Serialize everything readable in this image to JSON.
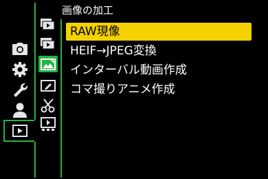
{
  "header": {
    "title": "画像の加工"
  },
  "menu": {
    "items": [
      {
        "label": "RAW現像",
        "selected": true
      },
      {
        "label": "HEIF→JPEG変換",
        "selected": false
      },
      {
        "label": "インターバル動画作成",
        "selected": false
      },
      {
        "label": "コマ撮りアニメ作成",
        "selected": false
      }
    ]
  },
  "tabs": {
    "main": [
      "camera-icon",
      "gear-icon",
      "wrench-icon",
      "person-icon",
      "playback-icon"
    ],
    "sub": [
      "playback-mode-icon",
      "display-icon",
      "image-edit-icon",
      "add-edit-info-icon",
      "delete-icon",
      "other-icon"
    ],
    "active_main": "playback-icon",
    "active_sub": "image-edit-icon"
  },
  "colors": {
    "accent": "#23b544",
    "highlight": "#f4d200",
    "background": "#000000"
  }
}
